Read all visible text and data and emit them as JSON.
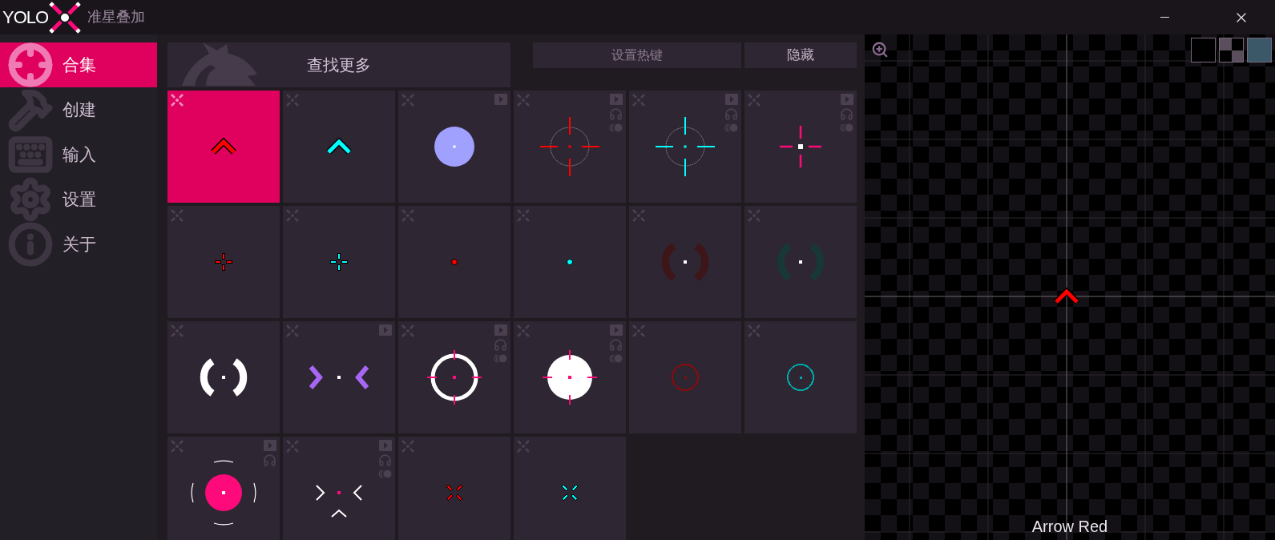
{
  "title_bar": {
    "logo": "YOLO",
    "title": "准星叠加"
  },
  "sidebar": {
    "items": [
      {
        "label": "合集",
        "selected": true
      },
      {
        "label": "创建",
        "selected": false
      },
      {
        "label": "输入",
        "selected": false
      },
      {
        "label": "设置",
        "selected": false
      },
      {
        "label": "关于",
        "selected": false
      }
    ]
  },
  "toolbar": {
    "find_more": "查找更多",
    "hotkey": "设置热键",
    "hide": "隐藏"
  },
  "tiles": [
    {
      "kind": "arrow",
      "color": "#ff0000",
      "selected": true,
      "video": false,
      "sound": false,
      "toggle": false
    },
    {
      "kind": "arrow",
      "color": "#00ffff",
      "selected": false,
      "video": false,
      "sound": false,
      "toggle": false
    },
    {
      "kind": "disc",
      "color": "#a0a0ff",
      "selected": false,
      "video": true,
      "sound": false,
      "toggle": false
    },
    {
      "kind": "circle-cross",
      "color": "#ff0000",
      "selected": false,
      "video": true,
      "sound": true,
      "toggle": true
    },
    {
      "kind": "circle-cross",
      "color": "#00ffff",
      "selected": false,
      "video": true,
      "sound": true,
      "toggle": true
    },
    {
      "kind": "cross",
      "color": "#ff0a7a",
      "selected": false,
      "video": true,
      "sound": true,
      "toggle": true
    },
    {
      "kind": "small-cross",
      "color": "#ff0000",
      "selected": false,
      "video": false,
      "sound": false,
      "toggle": false
    },
    {
      "kind": "small-cross",
      "color": "#00ffff",
      "selected": false,
      "video": false,
      "sound": false,
      "toggle": false
    },
    {
      "kind": "dot",
      "color": "#ff0000",
      "selected": false,
      "video": false,
      "sound": false,
      "toggle": false
    },
    {
      "kind": "dot",
      "color": "#00ffff",
      "selected": false,
      "video": false,
      "sound": false,
      "toggle": false
    },
    {
      "kind": "brackets",
      "color": "#3e1518",
      "selected": false,
      "video": false,
      "sound": false,
      "toggle": false
    },
    {
      "kind": "brackets",
      "color": "#183838",
      "selected": false,
      "video": false,
      "sound": false,
      "toggle": false
    },
    {
      "kind": "brackets",
      "color": "#ffffff",
      "selected": false,
      "video": false,
      "sound": false,
      "toggle": false
    },
    {
      "kind": "chevrons",
      "color": "#a866f5",
      "selected": false,
      "video": true,
      "sound": false,
      "toggle": false
    },
    {
      "kind": "ring-cross",
      "color": "#ffffff",
      "selected": false,
      "video": true,
      "sound": true,
      "toggle": true
    },
    {
      "kind": "disc-cross",
      "color": "#ffffff",
      "selected": false,
      "video": true,
      "sound": true,
      "toggle": true
    },
    {
      "kind": "small-ring",
      "color": "#8b0a0a",
      "selected": false,
      "video": false,
      "sound": false,
      "toggle": false
    },
    {
      "kind": "small-ring",
      "color": "#00a8a8",
      "selected": false,
      "video": false,
      "sound": false,
      "toggle": false
    },
    {
      "kind": "disc-arcs",
      "color": "#ff0a7a",
      "selected": false,
      "video": true,
      "sound": true,
      "toggle": false
    },
    {
      "kind": "chevrons-arrow",
      "color": "#ffffff",
      "selected": false,
      "video": true,
      "sound": true,
      "toggle": true
    },
    {
      "kind": "x",
      "color": "#ff0000",
      "selected": false,
      "video": false,
      "sound": false,
      "toggle": false
    },
    {
      "kind": "x",
      "color": "#00ffff",
      "selected": false,
      "video": false,
      "sound": false,
      "toggle": false
    }
  ],
  "preview": {
    "name": "Arrow Red",
    "kind": "arrow",
    "color": "#ff0000"
  }
}
